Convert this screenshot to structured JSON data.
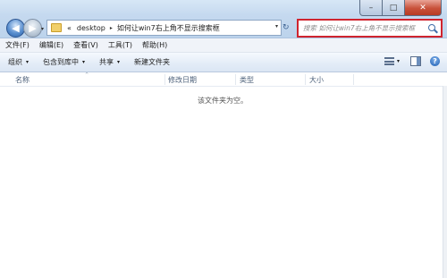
{
  "window": {
    "controls": {
      "minimize": "–",
      "maximize": "□",
      "close": "✕"
    }
  },
  "nav": {
    "back_glyph": "◀",
    "forward_glyph": "▶",
    "history_caret": "▾"
  },
  "address": {
    "prefix": "«",
    "segments": [
      "desktop",
      "如何让win7右上角不显示搜索框"
    ],
    "separator": "▸",
    "dropdown": "▾",
    "refresh_glyph": "↻"
  },
  "search": {
    "placeholder": "搜索 如何让win7右上角不显示搜索框"
  },
  "menubar": {
    "items": [
      "文件(F)",
      "编辑(E)",
      "查看(V)",
      "工具(T)",
      "帮助(H)"
    ]
  },
  "commandbar": {
    "organize": "组织",
    "include_in_library": "包含到库中",
    "share": "共享",
    "new_folder": "新建文件夹",
    "caret": "▾",
    "help_glyph": "?"
  },
  "columns": {
    "name": "名称",
    "modified": "修改日期",
    "type": "类型",
    "size": "大小",
    "sort_indicator": "^"
  },
  "content": {
    "empty_message": "该文件夹为空。"
  },
  "colors": {
    "search_highlight": "#d0242f",
    "title_gradient_top": "#d7e7f6"
  },
  "icons": [
    "back-icon",
    "forward-icon",
    "folder-icon",
    "refresh-icon",
    "search-icon",
    "views-icon",
    "preview-pane-icon",
    "help-icon"
  ]
}
